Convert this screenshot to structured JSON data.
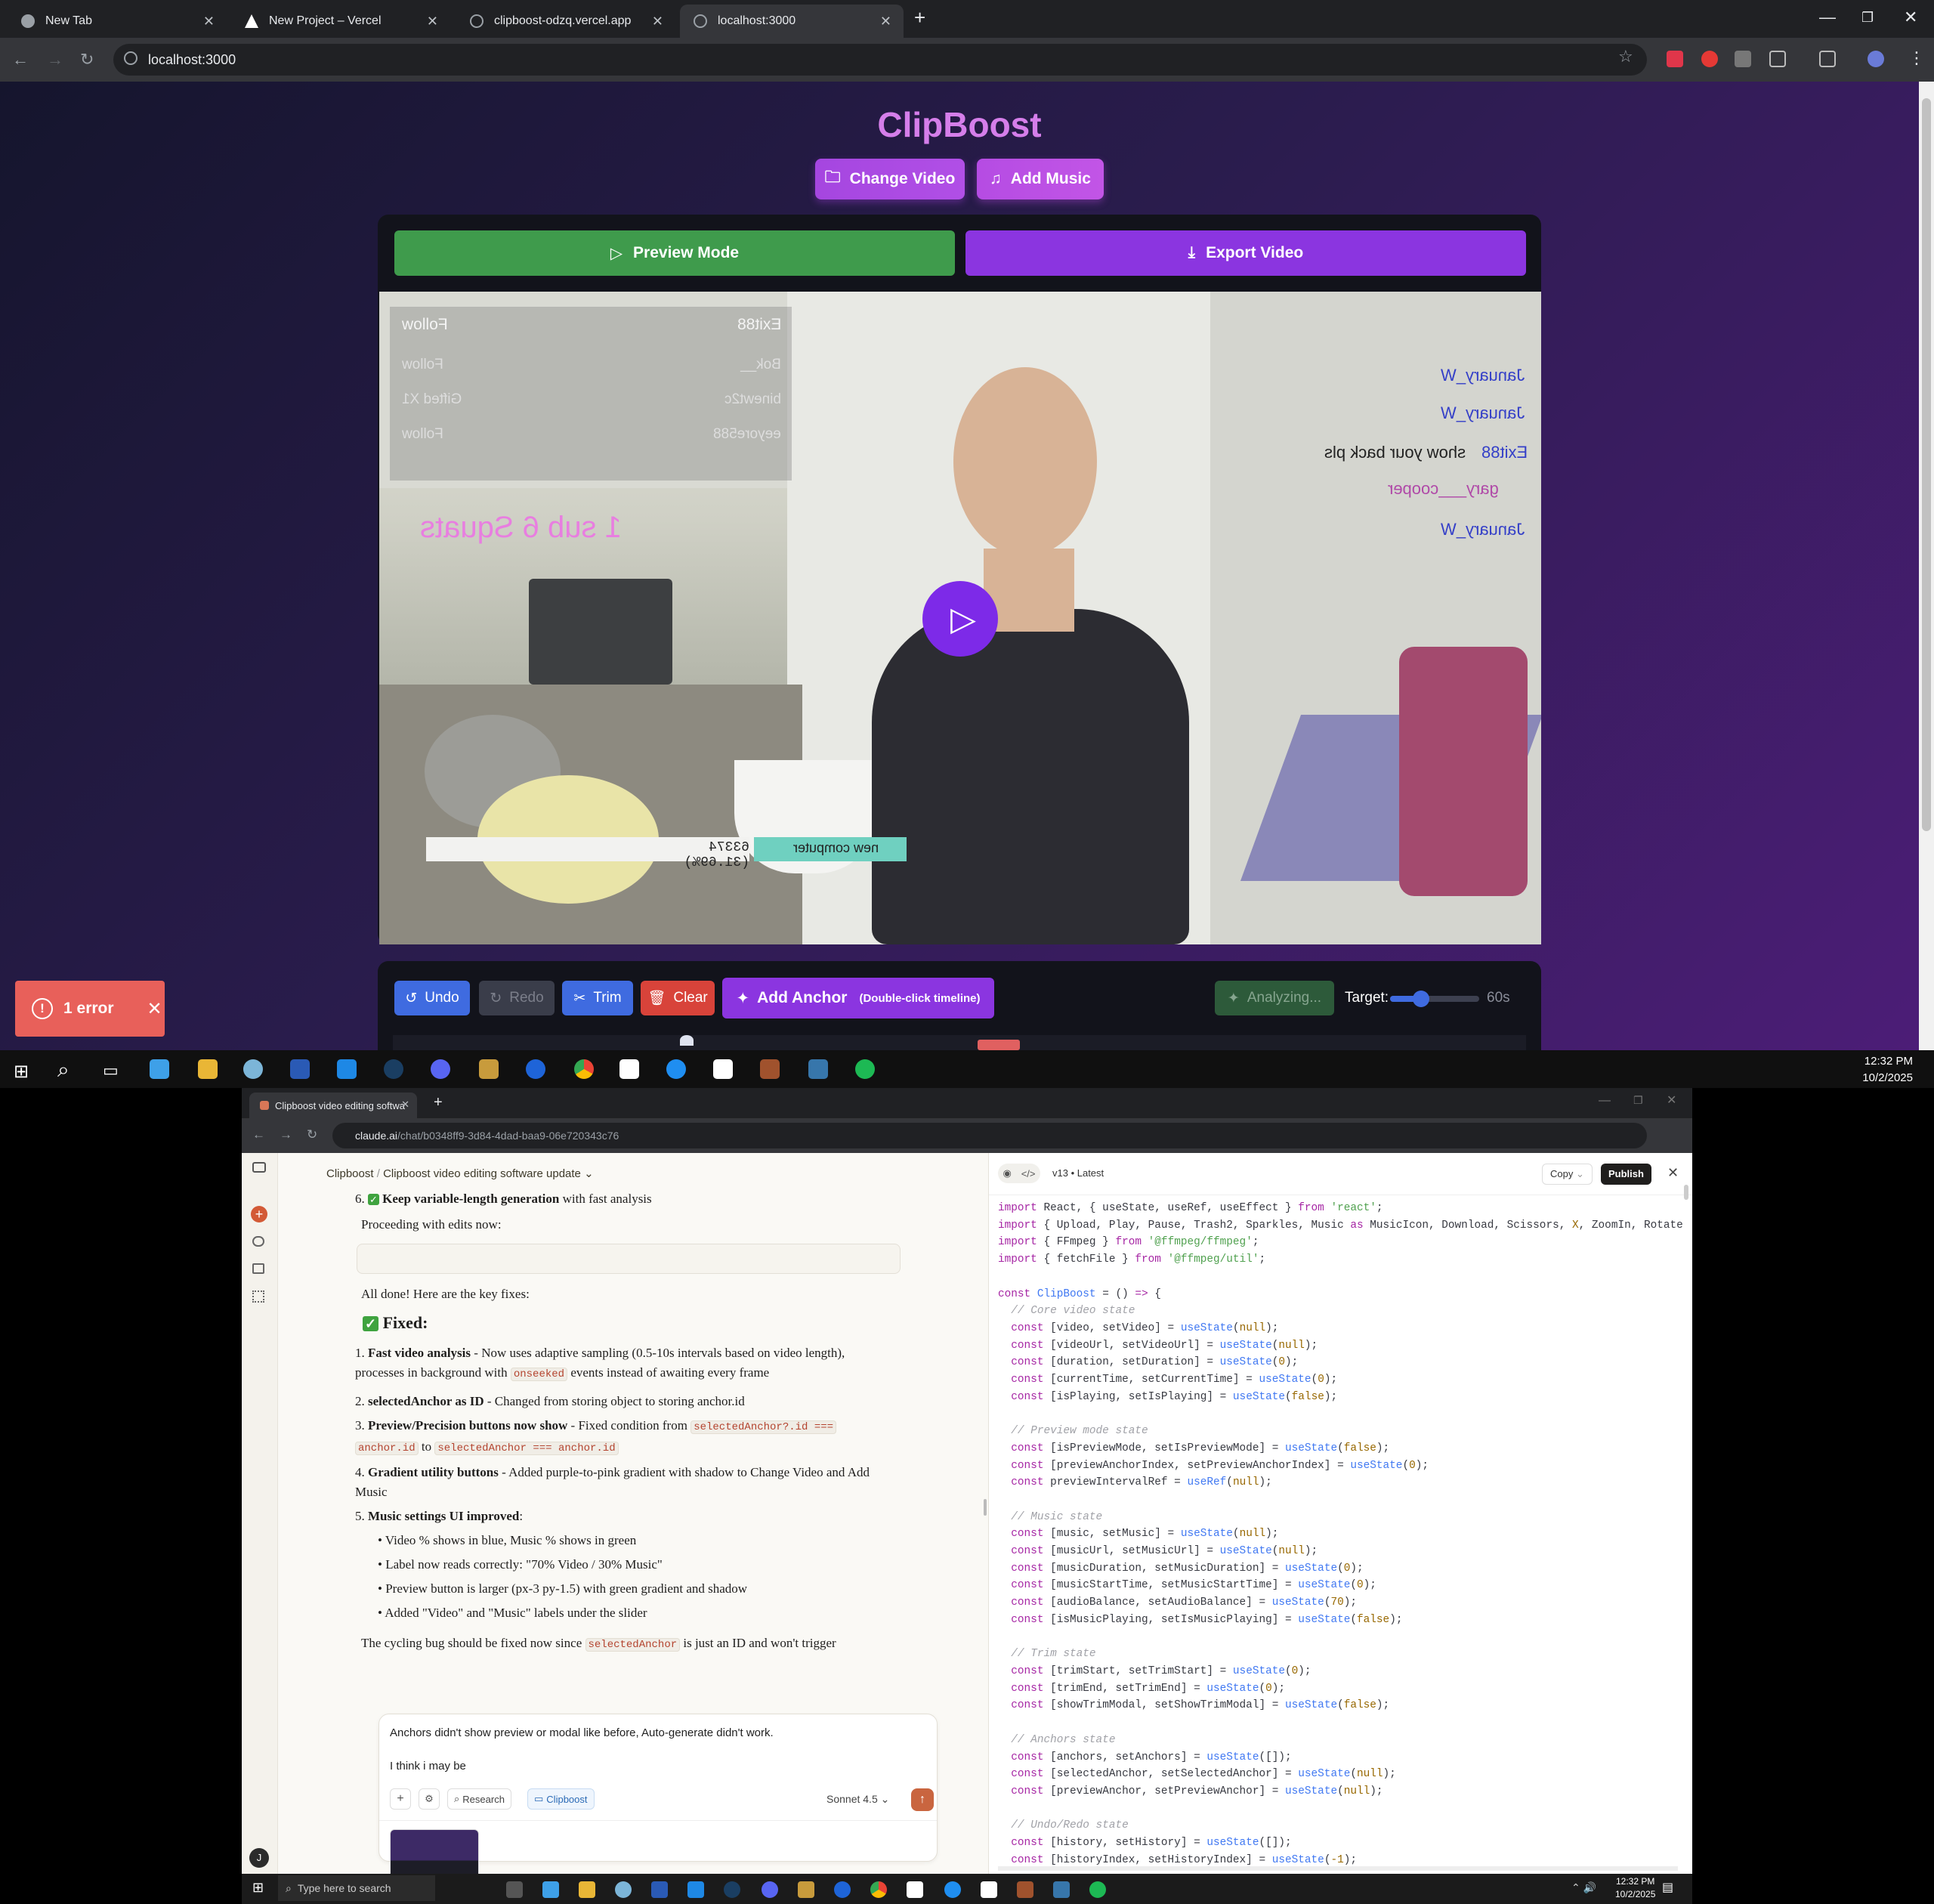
{
  "browser": {
    "tabs": [
      {
        "title": "New Tab",
        "favicon": "chrome-icon"
      },
      {
        "title": "New Project – Vercel",
        "favicon": "vercel-icon"
      },
      {
        "title": "clipboost-odzq.vercel.app",
        "favicon": "globe-icon"
      },
      {
        "title": "localhost:3000",
        "favicon": "globe-icon"
      }
    ],
    "url": "localhost:3000"
  },
  "app": {
    "title": "ClipBoost",
    "change_video": "Change Video",
    "add_music": "Add Music",
    "preview_mode": "Preview Mode",
    "export_video": "Export Video",
    "video_overlay": {
      "followers": [
        {
          "name": "Exit88",
          "action": "Follow"
        },
        {
          "name": "Bok__",
          "action": "Follow"
        },
        {
          "name": "binewt2c",
          "action": "Gifted X1"
        },
        {
          "name": "eeyore588",
          "action": "Follow"
        }
      ],
      "goal_text": "1 sub 6 Squats",
      "chat": [
        {
          "user": "January_W",
          "text": ""
        },
        {
          "user": "January_W",
          "text": ""
        },
        {
          "user": "Exit88",
          "text": "show your back pls"
        },
        {
          "user": "gary___cooper",
          "text": ""
        },
        {
          "user": "January_W",
          "text": ""
        }
      ],
      "bar_left": "63374 (31.69%)",
      "bar_right": "new computer"
    },
    "controls": {
      "undo": "Undo",
      "redo": "Redo",
      "trim": "Trim",
      "clear": "Clear",
      "add_anchor": "Add Anchor",
      "add_anchor_hint": "(Double-click timeline)",
      "analyzing": "Analyzing...",
      "target_label": "Target:",
      "target_value": "60s",
      "target_fraction": 0.35
    },
    "error_toast": "1 error"
  },
  "taskbar_top": {
    "time": "12:32 PM",
    "date": "10/2/2025"
  },
  "claude_window": {
    "tab_title": "Clipboost video editing softwa",
    "url_host": "claude.ai",
    "url_path": "/chat/b0348ff9-3d84-4dad-baa9-06e720343c76",
    "breadcrumb_project": "Clipboost",
    "breadcrumb_chat": "Clipboost video editing software update",
    "chat": {
      "item6_bold": "Keep variable-length generation",
      "item6_rest": " with fast analysis",
      "proceeding": "Proceeding with edits now:",
      "all_done": "All done! Here are the key fixes:",
      "fixed_heading": "Fixed:",
      "fix1_bold": "Fast video analysis",
      "fix1_a": " - Now uses adaptive sampling (0.5-10s intervals based on video length), processes in background with ",
      "fix1_code": "onseeked",
      "fix1_b": " events instead of awaiting every frame",
      "fix2_bold": "selectedAnchor as ID",
      "fix2_rest": " - Changed from storing object to storing anchor.id",
      "fix3_bold": "Preview/Precision buttons now show",
      "fix3_a": " - Fixed condition from ",
      "fix3_code1": "selectedAnchor?.id ===",
      "fix3_code2": "anchor.id",
      "fix3_to": " to ",
      "fix3_code3": "selectedAnchor === anchor.id",
      "fix4_bold": "Gradient utility buttons",
      "fix4_rest": " - Added purple-to-pink gradient with shadow to Change Video and Add Music",
      "fix5_bold": "Music settings UI improved",
      "fix5_rest": ":",
      "sub1": "Video % shows in blue, Music % shows in green",
      "sub2": "Label now reads correctly: \"70% Video / 30% Music\"",
      "sub3": "Preview button is larger (px-3 py-1.5) with green gradient and shadow",
      "sub4": "Added \"Video\" and \"Music\" labels under the slider",
      "cycling_a": "The cycling bug should be fixed now since ",
      "cycling_code": "selectedAnchor",
      "cycling_b": " is just an ID and won't trigger"
    },
    "composer": {
      "line1": "Anchors didn't show preview or modal like before, Auto-generate didn't work.",
      "line2": "I think i may be",
      "research": "Research",
      "project": "Clipboost",
      "model": "Sonnet 4.5"
    },
    "artifact": {
      "version": "v13 • Latest",
      "copy": "Copy",
      "publish": "Publish"
    },
    "avatar_initial": "J"
  },
  "taskbar_bottom": {
    "search_placeholder": "Type here to search",
    "time": "12:32 PM",
    "date": "10/2/2025"
  }
}
